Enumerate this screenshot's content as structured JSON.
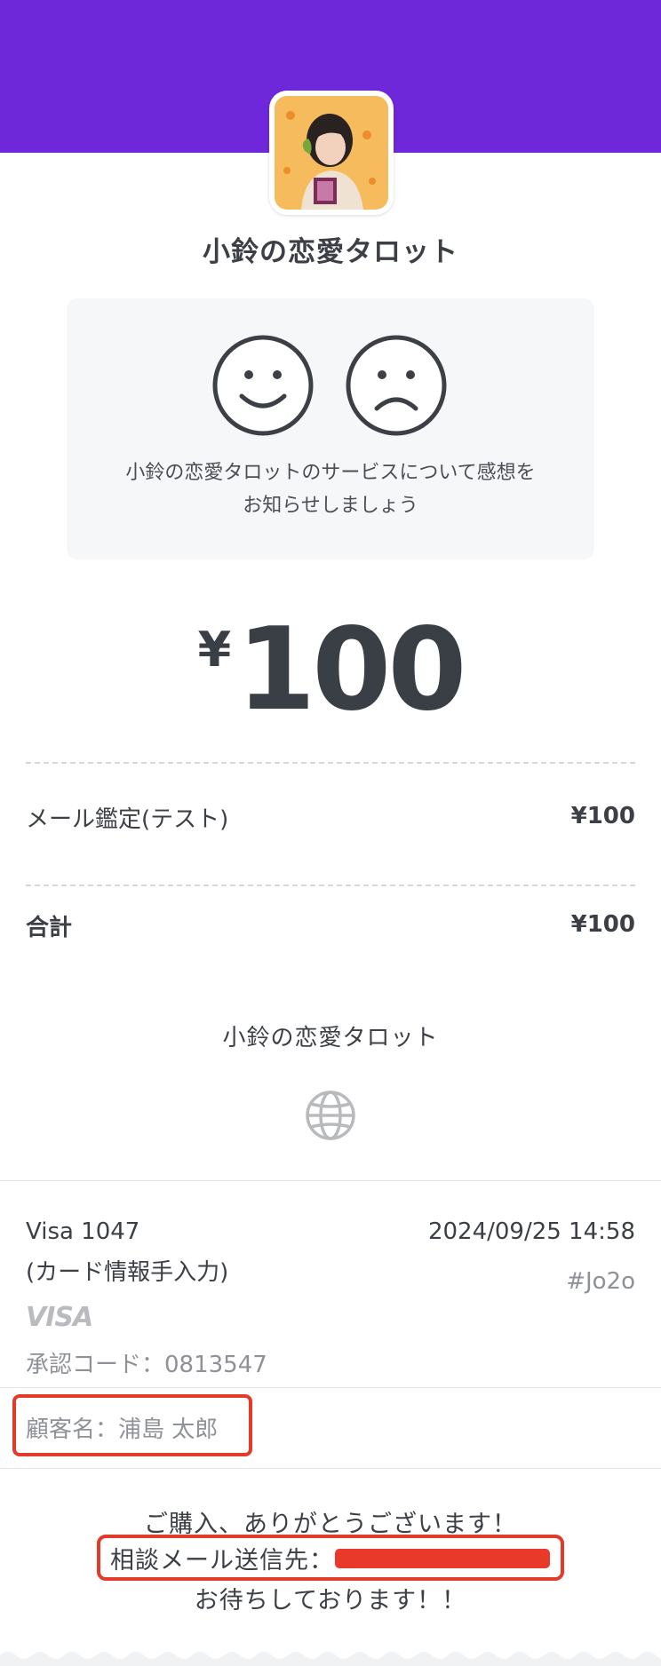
{
  "header": {
    "accent_color": "#6e28d9",
    "avatar_icon": "merchant-avatar-photo"
  },
  "merchant": {
    "name": "小鈴の恋愛タロット"
  },
  "feedback": {
    "happy_icon": "smiley-face-icon",
    "sad_icon": "frowning-face-icon",
    "prompt": "小鈴の恋愛タロットのサービスについて感想をお知らせしましょう"
  },
  "amount": {
    "currency": "¥",
    "value": "100"
  },
  "line_items": [
    {
      "label": "メール鑑定(テスト)",
      "value": "¥100"
    }
  ],
  "total": {
    "label": "合計",
    "value": "¥100"
  },
  "footer_merchant": {
    "name": "小鈴の恋愛タロット",
    "website_icon": "globe-icon"
  },
  "payment": {
    "card": "Visa 1047",
    "entry_method": "(カード情報手入力)",
    "datetime": "2024/09/25 14:58",
    "receipt_ref": "#Jo2o",
    "brand_logo": "VISA",
    "auth_code": "承認コード：0813547"
  },
  "customer": {
    "name_line": "顧客名：浦島 太郎"
  },
  "message": {
    "thanks": "ご購入、ありがとうございます！",
    "contact_label": "相談メール送信先：",
    "closing": "お待ちしております！！"
  }
}
